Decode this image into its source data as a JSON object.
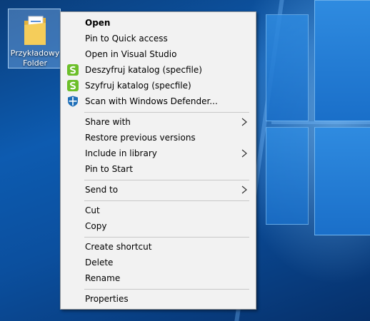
{
  "desktop": {
    "icon_label_line1": "Przykładowy",
    "icon_label_line2": "Folder",
    "icon": "folder-icon"
  },
  "menu": {
    "items": [
      {
        "label": "Open",
        "bold": true
      },
      {
        "label": "Pin to Quick access"
      },
      {
        "label": "Open in Visual Studio"
      },
      {
        "label": "Deszyfruj katalog (specfile)",
        "icon": "specfile-icon"
      },
      {
        "label": "Szyfruj katalog (specfile)",
        "icon": "specfile-icon"
      },
      {
        "label": "Scan with Windows Defender...",
        "icon": "windows-defender-icon"
      },
      {
        "label": "Share with",
        "submenu": true
      },
      {
        "label": "Restore previous versions"
      },
      {
        "label": "Include in library",
        "submenu": true
      },
      {
        "label": "Pin to Start"
      },
      {
        "label": "Send to",
        "submenu": true
      },
      {
        "label": "Cut"
      },
      {
        "label": "Copy"
      },
      {
        "label": "Create shortcut"
      },
      {
        "label": "Delete"
      },
      {
        "label": "Rename"
      },
      {
        "label": "Properties"
      }
    ]
  },
  "colors": {
    "specfile_green": "#6cbf2a",
    "defender_blue": "#1f6fb8",
    "menu_bg": "#f2f2f2"
  }
}
